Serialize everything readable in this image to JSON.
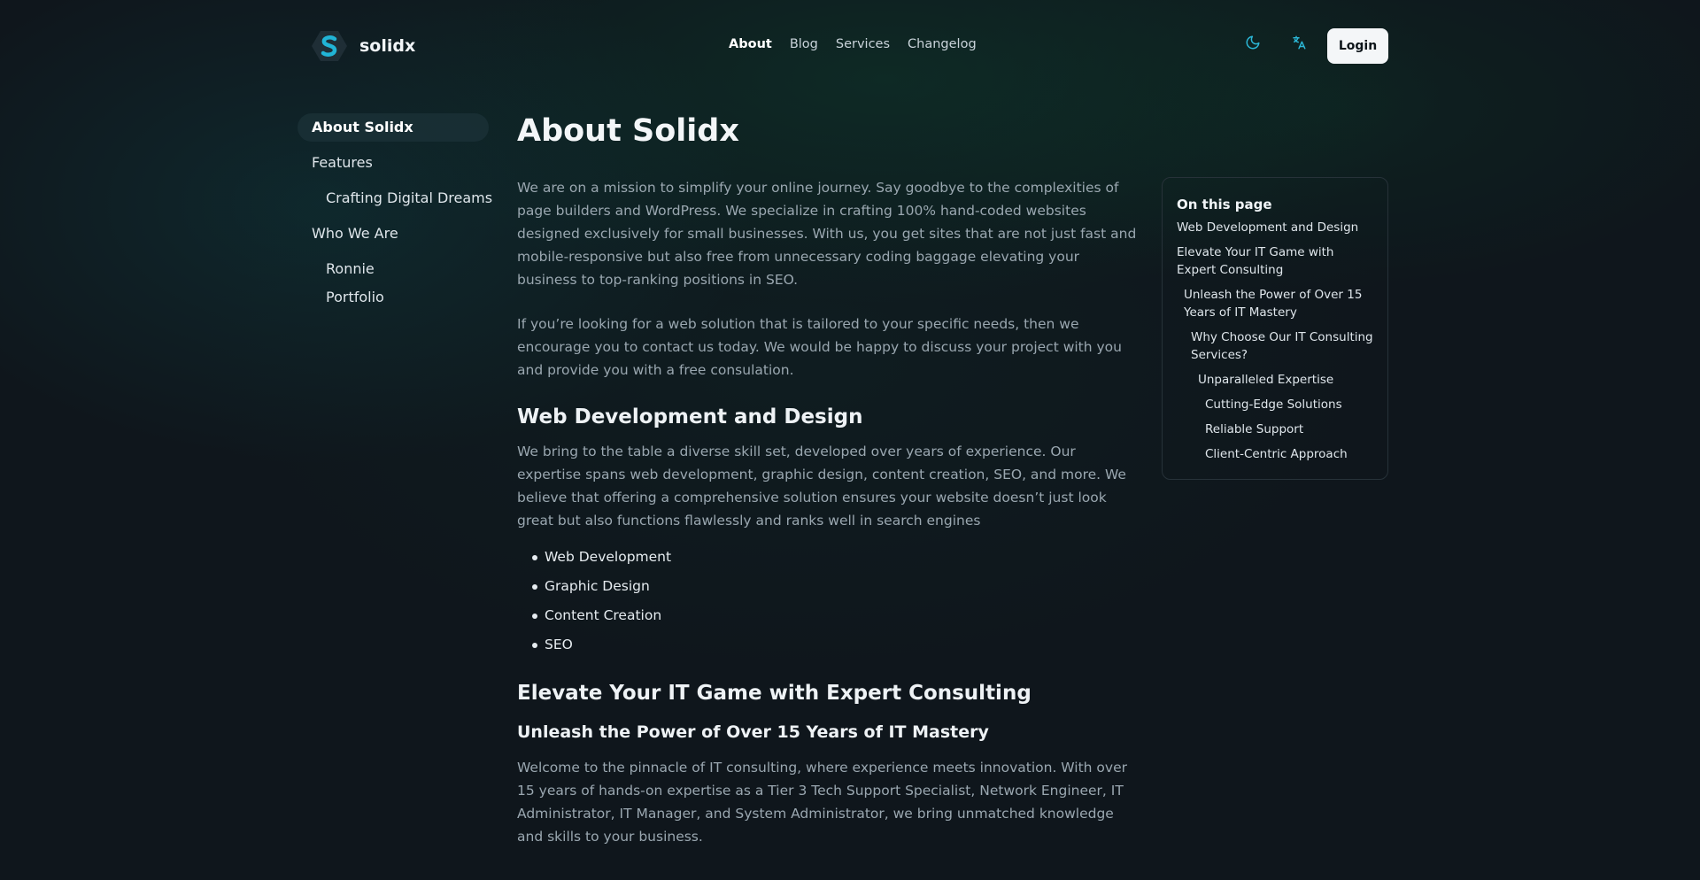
{
  "header": {
    "brand_name": "solidx",
    "logo_letter": "S",
    "nav": [
      {
        "label": "About"
      },
      {
        "label": "Blog"
      },
      {
        "label": "Services"
      },
      {
        "label": "Changelog"
      }
    ],
    "theme_icon": "moon-icon",
    "language_icon": "translate-icon",
    "login_label": "Login"
  },
  "sidebar": {
    "items": [
      {
        "label": "About Solidx"
      },
      {
        "label": "Features"
      },
      {
        "label": "Crafting Digital Dreams"
      },
      {
        "label": "Who We Are"
      },
      {
        "label": "Ronnie"
      },
      {
        "label": "Portfolio"
      }
    ]
  },
  "main": {
    "title": "About Solidx",
    "intro_p1": "We are on a mission to simplify your online journey. Say goodbye to the complexities of page builders and WordPress. We specialize in crafting 100% hand-coded websites designed exclusively for small businesses. With us, you get sites that are not just fast and mobile-responsive but also free from unnecessary coding baggage elevating your business to top-ranking positions in SEO.",
    "intro_p2": "If you’re looking for a web solution that is tailored to your specific needs, then we encourage you to contact us today. We would be happy to discuss your project with you and provide you with a free consulation.",
    "section1_heading": "Web Development and Design",
    "section1_p": "We bring to the table a diverse skill set, developed over years of experience. Our expertise spans web development, graphic design, content creation, SEO, and more. We believe that offering a comprehensive solution ensures your website doesn’t just look great but also functions flawlessly and ranks well in search engines",
    "skills": [
      "Web Development",
      "Graphic Design",
      "Content Creation",
      "SEO"
    ],
    "section2_heading": "Elevate Your IT Game with Expert Consulting",
    "section3_heading": "Unleash the Power of Over 15 Years of IT Mastery",
    "section3_p": "Welcome to the pinnacle of IT consulting, where experience meets innovation. With over 15 years of hands-on expertise as a Tier 3 Tech Support Specialist, Network Engineer, IT Administrator, IT Manager, and System Administrator, we bring unmatched knowledge and skills to your business."
  },
  "toc": {
    "title": "On this page",
    "links": [
      {
        "label": "Web Development and Design"
      },
      {
        "label": "Elevate Your IT Game with Expert Consulting"
      },
      {
        "label": "Unleash the Power of Over 15 Years of IT Mastery"
      },
      {
        "label": "Why Choose Our IT Consulting Services?"
      },
      {
        "label": "Unparalleled Expertise"
      },
      {
        "label": "Cutting-Edge Solutions"
      },
      {
        "label": "Reliable Support"
      },
      {
        "label": "Client-Centric Approach"
      }
    ]
  },
  "colors": {
    "background": "#0f161c",
    "accent": "#2bb7d6",
    "login_bg": "#f4f6f8"
  }
}
